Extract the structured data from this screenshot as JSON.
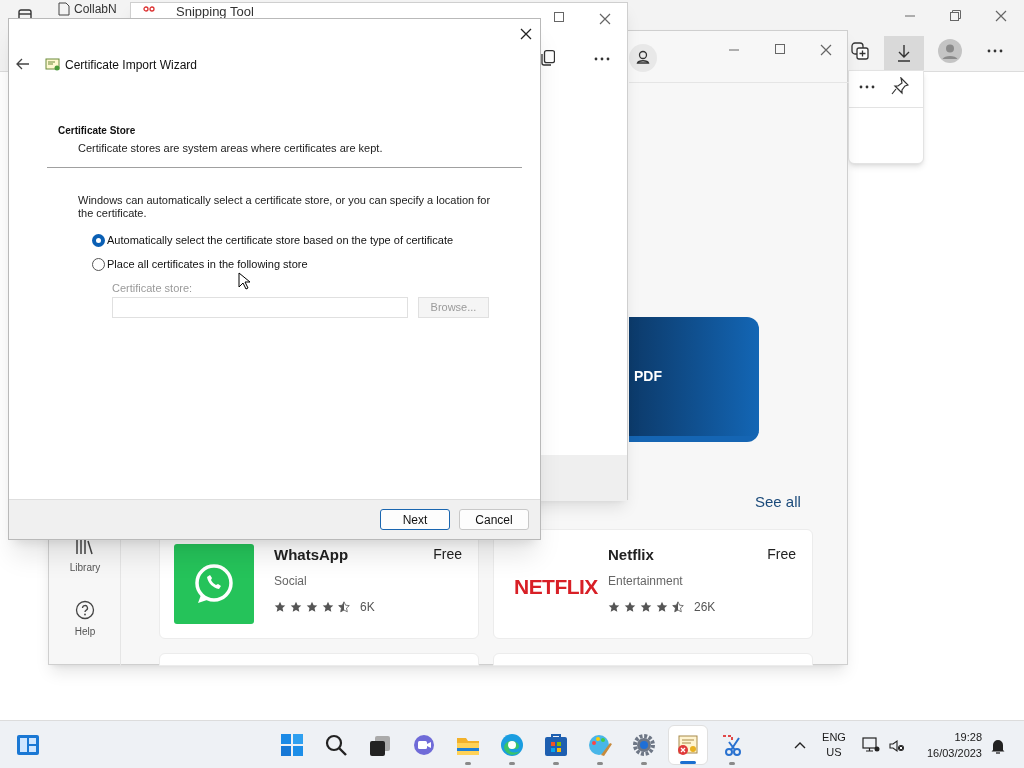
{
  "browser": {
    "tab": "CollabN"
  },
  "snipping_tool": {
    "title": "Snipping Tool"
  },
  "store": {
    "banner": "PDF",
    "see_all": "See all",
    "nav": [
      {
        "label": "Library",
        "kind": "library"
      },
      {
        "label": "Help",
        "kind": "help"
      }
    ],
    "apps": [
      {
        "name": "WhatsApp",
        "price": "Free",
        "category": "Social",
        "stars": 4.5,
        "count": "6K",
        "kind": "whatsapp"
      },
      {
        "name": "Netflix",
        "price": "Free",
        "category": "Entertainment",
        "stars": 4.5,
        "count": "26K",
        "kind": "netflix",
        "logo_text": "NETFLIX"
      }
    ]
  },
  "dialog": {
    "title": "Certificate Import Wizard",
    "heading": "Certificate Store",
    "subheading": "Certificate stores are system areas where certificates are kept.",
    "intro": "Windows can automatically select a certificate store, or you can specify a location for the certificate.",
    "options": [
      {
        "label": "Automatically select the certificate store based on the type of certificate",
        "selected": true
      },
      {
        "label": "Place all certificates in the following store",
        "selected": false
      }
    ],
    "store_label": "Certificate store:",
    "store_disabled": true,
    "browse": "Browse...",
    "buttons": [
      {
        "label": "Next",
        "default": true
      },
      {
        "label": "Cancel",
        "default": false
      }
    ]
  },
  "taskbar": {
    "apps": [
      {
        "kind": "start",
        "open": false,
        "selected": false
      },
      {
        "kind": "search",
        "open": false,
        "selected": false
      },
      {
        "kind": "taskview",
        "open": false,
        "selected": false
      },
      {
        "kind": "chat",
        "open": false,
        "selected": false
      },
      {
        "kind": "explorer",
        "open": true,
        "selected": false
      },
      {
        "kind": "edge",
        "open": true,
        "selected": false
      },
      {
        "kind": "store",
        "open": true,
        "selected": false
      },
      {
        "kind": "paint",
        "open": true,
        "selected": false
      },
      {
        "kind": "settings",
        "open": true,
        "selected": false
      },
      {
        "kind": "certificate",
        "open": true,
        "selected": true
      },
      {
        "kind": "snipping",
        "open": true,
        "selected": false
      }
    ],
    "language": "ENG",
    "region": "US",
    "time": "19:28",
    "date": "16/03/2023"
  }
}
